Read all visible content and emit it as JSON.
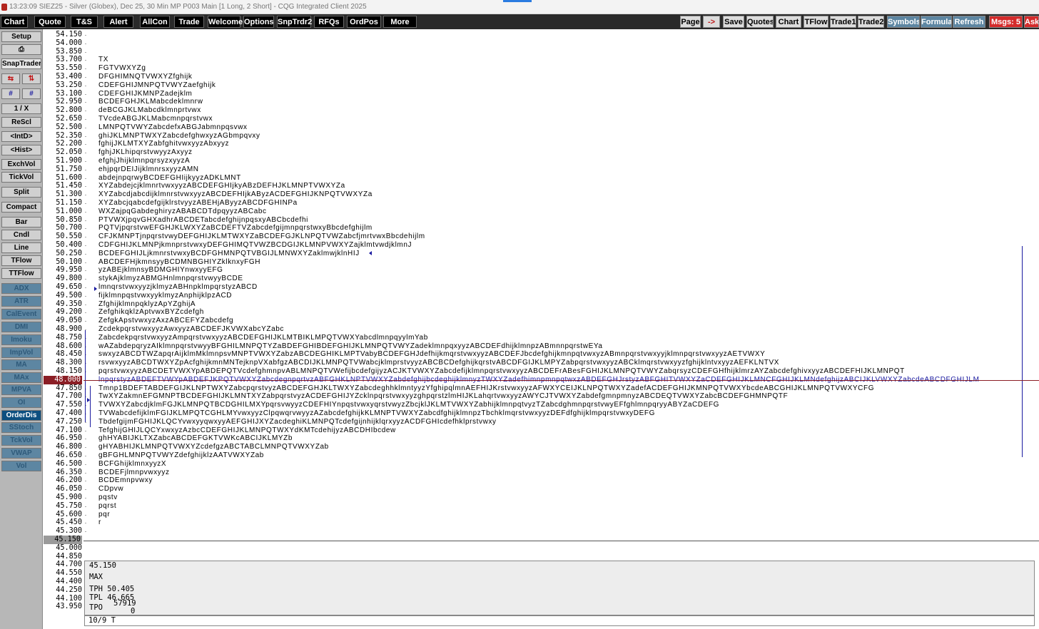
{
  "titlebar": {
    "text": "13:23:09  SIEZ25 - Silver (Globex), Dec 25, 30 Min MP   P003 Main   [1 Long, 2 Short] - CQG Integrated Client 2025"
  },
  "menu": [
    "Chart",
    "Quote",
    "T&S",
    "Alert",
    "AllCon",
    "Trade",
    "Welcome",
    "Options",
    "SnpTrdr2",
    "RFQs",
    "OrdPos",
    "More"
  ],
  "right_buttons": [
    "Page",
    "Save",
    "Quotes",
    "Chart",
    "TFlow",
    "Trade1",
    "Trade2",
    "Symbols",
    "Formula",
    "Refresh",
    "Msgs: 5",
    "Ask"
  ],
  "sidebar": {
    "setup": "Setup",
    "snaptrader": "SnapTrader",
    "one_over_x": "1 / X",
    "rescl": "ReScl",
    "intd": "<IntD>",
    "hist": "<Hist>",
    "exchvol": "ExchVol",
    "tickvol": "TickVol",
    "split": "Split",
    "compact": "Compact",
    "bar": "Bar",
    "cndl": "Cndl",
    "line": "Line",
    "tflow": "TFlow",
    "ttflow": "TTFlow",
    "studies": [
      "ADX",
      "ATR",
      "CalEvent",
      "DMI",
      "Imoku",
      "ImpVol",
      "MA",
      "MAx",
      "MPVA",
      "OI",
      "OrderDis",
      "SStoch",
      "TckVol",
      "VWAP",
      "Vol"
    ]
  },
  "prices": [
    "54.150",
    "54.000",
    "53.850",
    "53.700",
    "53.550",
    "53.400",
    "53.250",
    "53.100",
    "52.950",
    "52.800",
    "52.650",
    "52.500",
    "52.350",
    "52.200",
    "52.050",
    "51.900",
    "51.750",
    "51.600",
    "51.450",
    "51.300",
    "51.150",
    "51.000",
    "50.850",
    "50.700",
    "50.550",
    "50.400",
    "50.250",
    "50.100",
    "49.950",
    "49.800",
    "49.650",
    "49.500",
    "49.350",
    "49.200",
    "49.050",
    "48.900",
    "48.750",
    "48.600",
    "48.450",
    "48.300",
    "48.150",
    "48.000",
    "47.850",
    "47.700",
    "47.550",
    "47.400",
    "47.250",
    "47.100",
    "46.950",
    "46.800",
    "46.650",
    "46.500",
    "46.350",
    "46.200",
    "46.050",
    "45.900",
    "45.750",
    "45.600",
    "45.450",
    "45.300",
    "45.150",
    "45.000",
    "44.850",
    "44.700",
    "44.550",
    "44.400",
    "44.250",
    "44.100",
    "43.950"
  ],
  "current_price": "48.000",
  "selected_price": "45.150",
  "tpo_rows": [
    "",
    "",
    "",
    "TX",
    "FGTVWXYZg",
    "DFGHIMNQTVWXYZfghijk",
    "CDEFGHIJMNPQTVWYZaefghijk",
    "CDEFGHIJKMNPZadejklm",
    "BCDEFGHJKLMabcdeklmnrw",
    "deBCGJKLMabcdklmnprtvwx",
    "TVcdeABGJKLMabcmnpqrstvwx",
    "LMNPQTVWYZabcdefxABGJabmnpqsvwx",
    "ghiJKLMNPTWXYZabcdefghwxyzAGbmpqvxy",
    "fghijJKLMTXYZabfghitvwxyyzAbxyyz",
    "fghjJKLhipqrstvwyyzAxyyz",
    "efghjJhijklmnpqrsyzxyyzA",
    "ehjpqrDEIJijklmnrsxyyzAMN",
    "abdejnpqrwyBCDEFGHIijkyyzADKLMNT",
    "XYZabdejcjklmnrtvwxyyzABCDEFGHIjkyABzDEFHJKLMNPTVWXYZa",
    "XYZabcdjabcdijklmnrstvwxyyzABCDEFHIjkAByzACDEFGHIJKNPQTVWXYZa",
    "XYZabcjqabcdefgijklrstvyyzABEHjAByyzABCDFGHINPa",
    "WXZajpqGabdeghiryzABABCDTdpqyyzABCabc",
    "PTVWXjpqvGHXadhrABCDETabcdefghijnpqsxyABCbcdefhi",
    "PQTVjpqrstvwEFGHJKLWXYZaBCDEFTVZabcdefgijmnpqrstwxyBbcdefghijlm",
    "CFJKMNPTjnpqrstvwyDEFGHIJKLMTWXYZaBCDEFGJKLNPQTVWZabcfjmrtvwxBbcdehijlm",
    "CDFGHIJKLMNPjkmnprstvwxyDEFGHIMQTVWZBCDGIJKLMNPVWXYZajklmtvwdjklmnJ",
    "BCDEFGHIJLjkmnrstvwxyBCDFGHMNPQTVBGIJLMNWXYZaklmwjklnHIJ",
    "ABCDEFHjkmnsyyBCDMNBGHIYZklknxyFGH",
    "yzABEjklmnsyBDMGHIYnwxyyEFG",
    "stykAjklmyzABMGHnlmnpqrstvwyyBCDE",
    "lmnqrstvwxyyzjklmyzABHnpklmpqrstyzABCD",
    "fijklmnpqstvwxyyklmyzAnphijklpzACD",
    "ZfghijklmnpqklyzApYZghijA",
    "ZefghikqklzAptvwxBYZcdefgh",
    "ZefgkApstvwxyzAxzABCEFYZabcdefg",
    "ZcdekpqrstvwxyyzAwxyyzABCDEFJKVWXabcYZabc",
    "ZabcdekpqrstvwxyyzAmpqrstvwxyyzABCDEFGHIJKLMTBIKLMPQTVWXYabcdlmnpqyylmYab",
    "wAZabdepqryzAIklmnpqrstvwyyBFGHILMNPQTYZaBDEFGHIBDEFGHIJKLMNPQTVWYZadeklmnpqxyyzABCDEFdhijklmnpzABmnnpqrstwEYa",
    "swxyzABCDTWZapqrAijklmMklmnpsvMNPTVWXYZabzABCDEGHIKLMPTVabyBCDEFGHJdefhijkmqrstvwxyyzABCDEFJbcdefghijkmnpqtvwxyzABmnpqrstvwxyyjklmnpqrstvwxyyzAETVWXY",
    "rsvwxyyzABCDTWXYZpAcfghijkmnMNTejknpVXabfgzABCDIJKLMNPQTVWabcjklmprstvyyzABCBCDefghijkqrstvABCDFGIJKLMPYZabpqrstvwxyyzABCklmqrstvwxyyzfghijklntvxyyzAEFKLNTVX",
    "pqrstvwxyyzABCDETVWXYpABDEPQTVcdefghmnpvABLMNPQTVWefijbcdefgijyzACJKTVWXYZabcdefijklmnpqrstvwxyyzABCDEFrABesFGHIJKLMNPQTVWYZabqrsyzCDEFGHfhijklmrzAYZabcdefghivxyyzABCDEFHIJKLMNPQT",
    "lnpqrstyzABDEFTVWYpABDEFJKPQTVWXYZabcdegnpqrtvzABFGHKLNPTVWXYZabdefghijbcdeghijklmnyzTWXYZadefhimnpmnpqtwxzABDEFGHJrstyzABFGHITVWXYZaCDEFGHIJKLMNCFGHIJKLMNdefghijzABCIJKLVWXYZabcdeABCDFGHIJLM",
    "Tmnp1BDEFTABDEFGIJKLNPTWXYZabcpqrstvyzABCDEFGHJKLTWXYZabcdeghhklmntyyzYfghipqlmnAEFHIJKrstvwxyyzAFWXYCEIJKLNPQTWXYZadefACDEFGHIJKMNPQTVWXYbcdeABCGHIJKLMNPQTVWXYCFG",
    "TwXYZakmnEFGMNPTBCDEFGHIJKLMNTXYZabpqrstvyzACDEFGHIJYZcklnpqrstvwxyyzghpqrstzlmHIJKLahqrtvwxyyzAWYCJTVWXYZabdefgmnpmnyzABCDEQTVWXYZabcBCDEFGHMNPQTF",
    "TVWXYZabcdjklmFGJKLMNPQTBCDGHILMXYpqrsvwyyzCDEFHIYnpqstvwxyqrstvwyzZbcjklJKLMTVWXYZabhijklmnpqtvyzTZabcdghmnpqrstvwyEFfghlmnpqryyABYZaCDEFG",
    "TVWabcdefijklmFGIJKLMPQTCGHLMYvwxyyzClpqwqrvwyyzAZabcdefghijkKLMNPTVWXYZabcdfghijklmnpzTbchklmqrstvwxyyzDEFdfghijklmpqrstvwxyDEFG",
    "TbdefgijmFGHIJKLQCYvwxyyqwxyyAEFGHIJXYZacdeghiKLMNPQTcdefgijnhijklqrxyyzACDFGHIcdefhklprstvwxy",
    "TefghijGHIJLQCYxwxyzAzbcCDEFGHIJKLMNPQTWXYdKMTcdehijyzABCDHIbcdew",
    "ghHYABIJKLTXZabcABCDEFGKTVWKcABCIJKLMYZb",
    "gHYABHIJKLMNPQTVWXYZcdefgzABCTABCLMNPQTVWXYZab",
    "gBFGHLMNPQTVWYZdefghijklzAATVWXYZab",
    "BCFGhijklmnxyyzX",
    "BCDEFjlmnpvwxyyz",
    "BCDEmnpvwxy",
    "CDpvw",
    "pqstv",
    "pqrst",
    "pqr",
    "r",
    "",
    "",
    "",
    "",
    "",
    "",
    "",
    "",
    "",
    ""
  ],
  "info": {
    "price": "45.150",
    "max": "MAX",
    "tph": "TPH 50.405",
    "tpl": "TPL 46.665",
    "tpo_label": "TPO",
    "tpo_value": "57919",
    "tpo_zero": "0"
  },
  "status": "10/9 T",
  "colors": {
    "current": "#8b1e25",
    "value_area": "#1a1aa0",
    "study_button": "#5d86a2",
    "msgs": "#d42b2b",
    "menu": "#000000"
  }
}
